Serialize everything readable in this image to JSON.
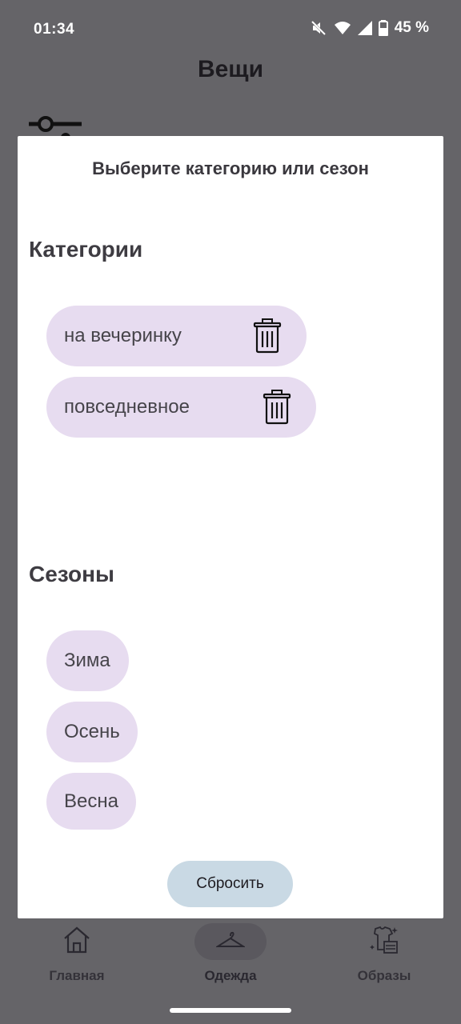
{
  "status_bar": {
    "time": "01:34",
    "battery": "45 %",
    "icons": [
      "mute-icon",
      "wifi-icon",
      "signal-icon",
      "battery-icon"
    ]
  },
  "app": {
    "title": "Вещи",
    "filter_icon": "filter-sliders-icon"
  },
  "dialog": {
    "title": "Выберите категорию или сезон",
    "categories_heading": "Категории",
    "categories": [
      {
        "label": "на вечеринку",
        "icon": "trash-icon"
      },
      {
        "label": "повседневное",
        "icon": "trash-icon"
      }
    ],
    "seasons_heading": "Сезоны",
    "seasons": [
      {
        "label": "Зима"
      },
      {
        "label": "Осень"
      },
      {
        "label": "Весна"
      }
    ],
    "reset_label": "Сбросить"
  },
  "bottom_nav": {
    "items": [
      {
        "label": "Главная",
        "icon": "home-icon"
      },
      {
        "label": "Одежда",
        "icon": "hanger-icon",
        "active": true
      },
      {
        "label": "Образы",
        "icon": "outfits-icon"
      }
    ]
  },
  "colors": {
    "scrim_background": "#656468",
    "chip": "#e7dcf0",
    "reset_button": "#c9d9e4",
    "dialog": "#ffffff"
  }
}
